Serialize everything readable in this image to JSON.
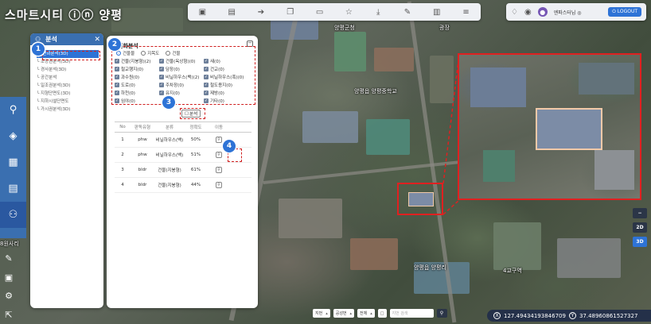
{
  "app": {
    "title": "스마트시티 ⓘⓝ 양평"
  },
  "toolbar": {
    "icons": [
      "layers-icon",
      "document-icon",
      "export-icon",
      "copy-icon",
      "image-icon",
      "star-icon",
      "download-icon",
      "draw-icon",
      "bookmark-icon",
      "ruler-icon"
    ]
  },
  "user": {
    "name": "엔파스터님 ◎",
    "logout": "LOGOUT"
  },
  "analysis_menu": {
    "title": "분석",
    "items": [
      {
        "label": "AI변화분석(3D)",
        "active": true
      },
      {
        "label": "└ 조망권분석(3D)",
        "active": false
      },
      {
        "label": "└ 경사분석(3D)",
        "active": false
      },
      {
        "label": "└ 공간분석",
        "active": false
      },
      {
        "label": "└ 일조권분석(3D)",
        "active": false
      },
      {
        "label": "└ 지형단면도(3D)",
        "active": false
      },
      {
        "label": "└ 지하시설단면도",
        "active": false
      },
      {
        "label": "└ 가시권분석(3D)",
        "active": false
      }
    ]
  },
  "change_analysis": {
    "title": "변화분석",
    "options": [
      "건물물",
      "지목도",
      "건물"
    ],
    "classes": [
      "건물(지붕형)(2)",
      "건물(옥상형)(0)",
      "새(0)",
      "철교행지(0)",
      "담장(0)",
      "건교(0)",
      "과수원(0)",
      "비닐하우스(백)(2)",
      "비닐하우스(흑)(0)",
      "도로(0)",
      "주차장(0)",
      "철도용지(0)",
      "하천(0)",
      "유지(0)",
      "제방(0)",
      "임야(0)",
      "",
      "기타(0)"
    ],
    "button": "분석",
    "columns": [
      "No",
      "판독유형",
      "분류",
      "정확도",
      "이동"
    ],
    "rows": [
      {
        "no": "1",
        "type": "phw",
        "cls": "비닐하우스(백)",
        "acc": "50%"
      },
      {
        "no": "2",
        "type": "phw",
        "cls": "비닐하우스(백)",
        "acc": "51%"
      },
      {
        "no": "3",
        "type": "bldr",
        "cls": "건물(지붕형)",
        "acc": "61%"
      },
      {
        "no": "4",
        "type": "bldr",
        "cls": "건물(지붕형)",
        "acc": "44%"
      }
    ]
  },
  "badges": [
    "1",
    "2",
    "3",
    "4"
  ],
  "map_labels": [
    "양평군청",
    "광장",
    "양평읍 양평중학교",
    "양평읍 양평리",
    "8원사리",
    "4교구역"
  ],
  "view_controls": {
    "zoom_out": "−",
    "two_d": "2D",
    "three_d": "3D"
  },
  "bottom_bar": {
    "sel1": "지번",
    "sel2": "공성번",
    "sel3": "전체",
    "search_placeholder": "지번 검색",
    "x_label": "X",
    "x_value": "127.49434193846709",
    "y_label": "Y",
    "y_value": "37.48960861527327"
  },
  "colors": {
    "accent": "#2e73d6",
    "annotation": "#e02020",
    "header": "#3a6fb0"
  }
}
